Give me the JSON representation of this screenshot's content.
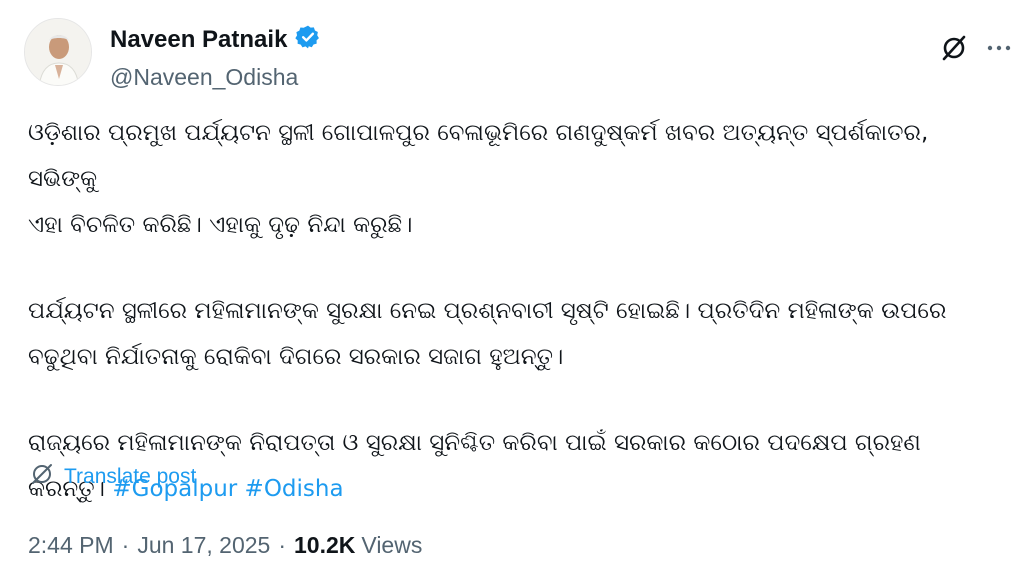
{
  "author": {
    "name": "Naveen Patnaik",
    "handle": "@Naveen_Odisha",
    "verified_color": "#1d9bf0"
  },
  "icons": {
    "verified": "verified-badge-icon",
    "grok": "grok-icon",
    "more": "more-icon",
    "translate": "translate-icon"
  },
  "post": {
    "paragraph_1": "ଓଡ଼ିଶାର ପ୍ରମୁଖ ପର୍ଯ୍ୟଟନ ସ୍ଥଳୀ ଗୋପାଳପୁର ବେଳାଭୂମିରେ ଗଣଦୁଷ୍କର୍ମ ଖବର ଅତ୍ୟନ୍ତ ସ୍ପର୍ଶକାତର, ସଭିଙ୍କୁ\nଏହା ବିଚଳିତ କରିଛି। ଏହାକୁ ଦୃଢ଼ ନିନ୍ଦା କରୁଛି।",
    "paragraph_2": "ପର୍ଯ୍ୟଟନ ସ୍ଥଳୀରେ ମହିଳାମାନଙ୍କ ସୁରକ୍ଷା ନେଇ ପ୍ରଶ୍ନବାଚୀ ସୃଷ୍ଟି ହୋଇଛି। ପ୍ରତିଦିନ ମହିଳାଙ୍କ ଉପରେ\nବଢୁଥିବା ନିର୍ଯାତନାକୁ ରୋକିବା ଦିଗରେ ସରକାର ସଜାଗ ହୁଅନ୍ତୁ।",
    "paragraph_3": "ରାଜ୍ୟରେ ମହିଳାମାନଙ୍କ ନିରାପତ୍ତା ଓ ସୁରକ୍ଷା ସୁନିଶ୍ଚିତ କରିବା ପାଇଁ ସରକାର କଠୋର ପଦକ୍ଷେପ ଗ୍ରହଣ\nକରନ୍ତୁ।",
    "hashtags": [
      "#Gopalpur",
      "#Odisha"
    ]
  },
  "translate_label": "Translate post",
  "meta": {
    "time": "2:44 PM",
    "separator": "·",
    "date": "Jun 17, 2025",
    "views_count": "10.2K",
    "views_label": "Views"
  }
}
